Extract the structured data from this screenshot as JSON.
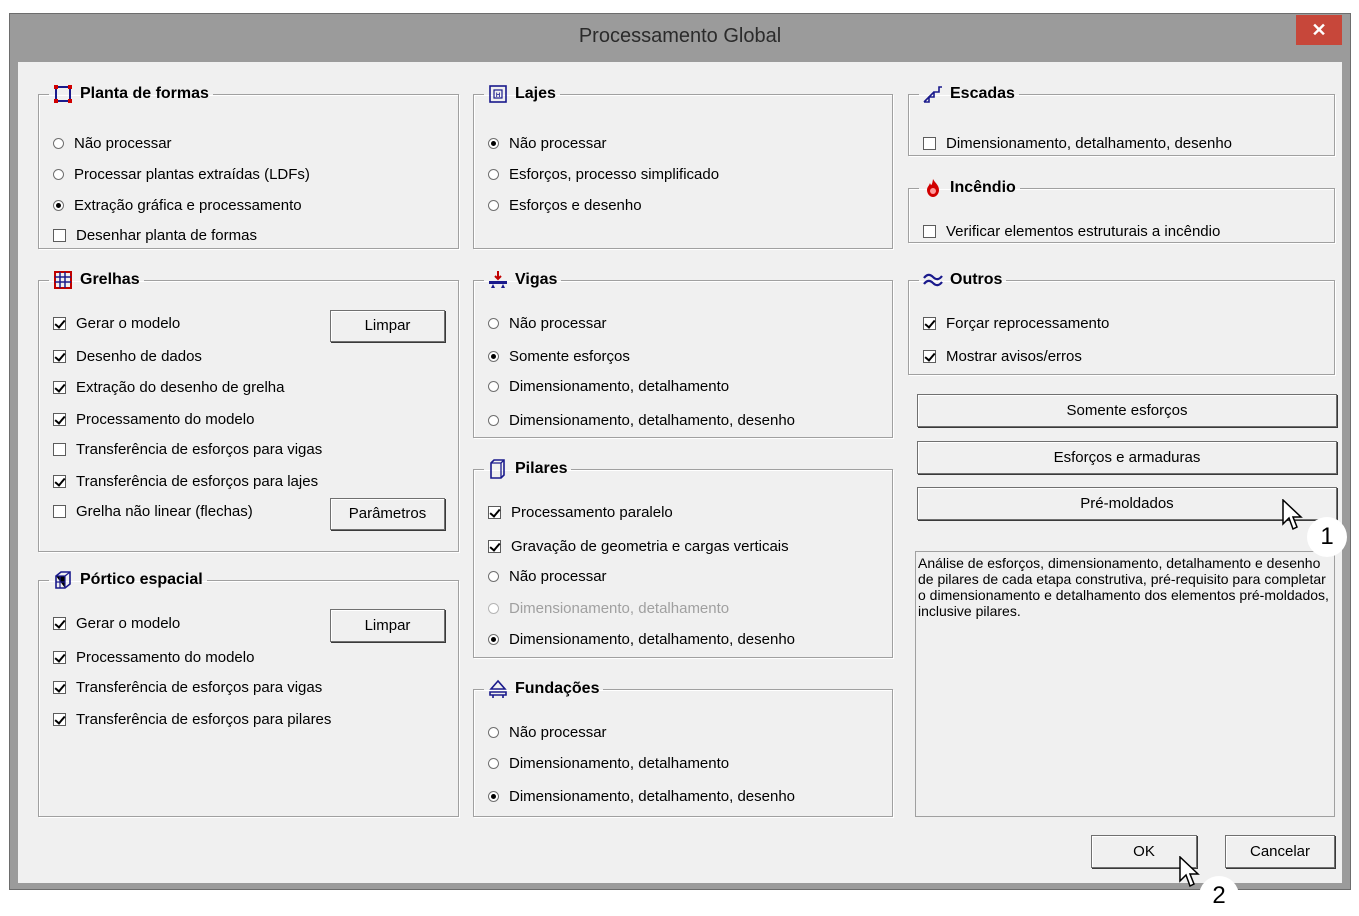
{
  "window": {
    "title": "Processamento Global",
    "close_glyph": "✕"
  },
  "planta": {
    "label": "Planta de formas",
    "icon": "frame-square-icon",
    "items": [
      {
        "label": "Não processar",
        "type": "radio",
        "checked": false
      },
      {
        "label": "Processar plantas extraídas (LDFs)",
        "type": "radio",
        "checked": false
      },
      {
        "label": "Extração gráfica e processamento",
        "type": "radio",
        "checked": true
      },
      {
        "label": "Desenhar planta de formas",
        "type": "check",
        "checked": false
      }
    ]
  },
  "grelhas": {
    "label": "Grelhas",
    "icon": "grid-icon",
    "clear_label": "Limpar",
    "params_label": "Parâmetros",
    "items": [
      {
        "label": "Gerar o modelo",
        "checked": true
      },
      {
        "label": "Desenho de dados",
        "checked": true
      },
      {
        "label": "Extração do desenho de grelha",
        "checked": true
      },
      {
        "label": "Processamento do modelo",
        "checked": true
      },
      {
        "label": "Transferência de esforços para vigas",
        "checked": false
      },
      {
        "label": "Transferência de esforços para lajes",
        "checked": true
      },
      {
        "label": "Grelha não linear (flechas)",
        "checked": false
      }
    ]
  },
  "portico": {
    "label": "Pórtico espacial",
    "icon": "frame-3d-icon",
    "clear_label": "Limpar",
    "items": [
      {
        "label": "Gerar o modelo",
        "checked": true
      },
      {
        "label": "Processamento do modelo",
        "checked": true
      },
      {
        "label": "Transferência de esforços para vigas",
        "checked": true
      },
      {
        "label": "Transferência de esforços para pilares",
        "checked": true
      }
    ]
  },
  "lajes": {
    "label": "Lajes",
    "icon": "slab-icon",
    "items": [
      {
        "label": "Não processar",
        "checked": true
      },
      {
        "label": "Esforços, processo simplificado",
        "checked": false
      },
      {
        "label": "Esforços e desenho",
        "checked": false
      }
    ]
  },
  "vigas": {
    "label": "Vigas",
    "icon": "beam-load-icon",
    "items": [
      {
        "label": "Não processar",
        "checked": false
      },
      {
        "label": "Somente esforços",
        "checked": true
      },
      {
        "label": "Dimensionamento, detalhamento",
        "checked": false
      },
      {
        "label": "Dimensionamento, detalhamento, desenho",
        "checked": false
      }
    ]
  },
  "pilares": {
    "label": "Pilares",
    "icon": "column-icon",
    "items": [
      {
        "label": "Processamento paralelo",
        "type": "check",
        "checked": true,
        "disabled": false
      },
      {
        "label": "Gravação de geometria e cargas verticais",
        "type": "check",
        "checked": true,
        "disabled": false
      },
      {
        "label": "Não processar",
        "type": "radio",
        "checked": false,
        "disabled": false
      },
      {
        "label": "Dimensionamento, detalhamento",
        "type": "radio",
        "checked": false,
        "disabled": true
      },
      {
        "label": "Dimensionamento, detalhamento, desenho",
        "type": "radio",
        "checked": true,
        "disabled": false
      }
    ]
  },
  "fundacoes": {
    "label": "Fundações",
    "icon": "foundation-icon",
    "items": [
      {
        "label": "Não processar",
        "checked": false
      },
      {
        "label": "Dimensionamento, detalhamento",
        "checked": false
      },
      {
        "label": "Dimensionamento, detalhamento, desenho",
        "checked": true
      }
    ]
  },
  "escadas": {
    "label": "Escadas",
    "icon": "stairs-icon",
    "items": [
      {
        "label": "Dimensionamento, detalhamento, desenho",
        "checked": false
      }
    ]
  },
  "incendio": {
    "label": "Incêndio",
    "icon": "fire-icon",
    "items": [
      {
        "label": "Verificar elementos estruturais a incêndio",
        "checked": false
      }
    ]
  },
  "outros": {
    "label": "Outros",
    "icon": "approx-icon",
    "items": [
      {
        "label": "Forçar reprocessamento",
        "checked": true
      },
      {
        "label": "Mostrar avisos/erros",
        "checked": true
      }
    ]
  },
  "presets": {
    "somente": "Somente esforços",
    "esforcos": "Esforços e armaduras",
    "premoldados": "Pré-moldados"
  },
  "description": "Análise de esforços, dimensionamento, detalhamento e desenho de pilares de cada etapa construtiva, pré-requisito para completar o dimensionamento e detalhamento dos elementos pré-moldados, inclusive pilares.",
  "footer": {
    "ok": "OK",
    "cancel": "Cancelar"
  },
  "annotations": {
    "step1": "1",
    "step2": "2"
  }
}
